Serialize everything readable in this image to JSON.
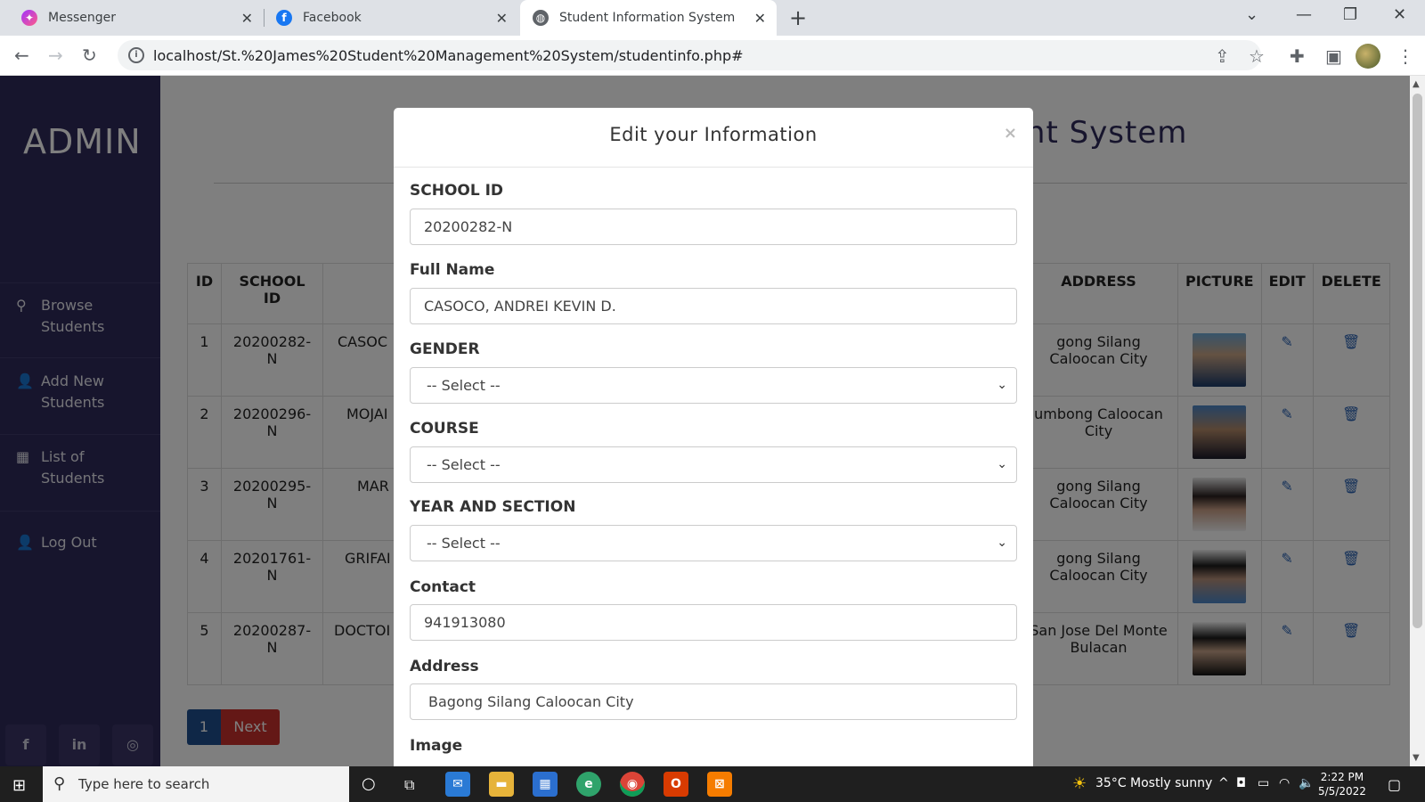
{
  "browser": {
    "tabs": [
      {
        "title": "Messenger",
        "icon": "messenger-icon"
      },
      {
        "title": "Facebook",
        "icon": "facebook-icon"
      },
      {
        "title": "Student Information System",
        "icon": "globe-icon"
      }
    ],
    "url": "localhost/St.%20James%20Student%20Management%20System/studentinfo.php#"
  },
  "sidebar": {
    "title": "ADMIN",
    "items": [
      {
        "label": "Browse Students",
        "icon": "search-icon"
      },
      {
        "label": "Add New Students",
        "icon": "user-icon"
      },
      {
        "label": "List of Students",
        "icon": "table-icon"
      },
      {
        "label": "Log Out",
        "icon": "user-icon"
      }
    ],
    "social": [
      "facebook-icon",
      "linkedin-icon",
      "github-icon"
    ]
  },
  "main": {
    "title_fragment": "ent System",
    "table": {
      "headers": [
        "ID",
        "SCHOOL ID",
        "ADDRESS",
        "PICTURE",
        "EDIT",
        "DELETE"
      ],
      "rows": [
        {
          "id": "1",
          "school_id": "20200282-N",
          "name": "CASOC",
          "address": "gong Silang Caloocan City"
        },
        {
          "id": "2",
          "school_id": "20200296-N",
          "name": "MOJAI",
          "address": "umbong Caloocan City"
        },
        {
          "id": "3",
          "school_id": "20200295-N",
          "name": "MAR",
          "address": "gong Silang Caloocan City"
        },
        {
          "id": "4",
          "school_id": "20201761-N",
          "name": "GRIFAI",
          "address": "gong Silang Caloocan City"
        },
        {
          "id": "5",
          "school_id": "20200287-N",
          "name": "DOCTOI",
          "address": "San Jose Del Monte Bulacan"
        }
      ]
    },
    "pagination": {
      "page": "1",
      "next": "Next"
    }
  },
  "modal": {
    "title": "Edit your Information",
    "close": "×",
    "fields": {
      "school_id": {
        "label": "SCHOOL ID",
        "value": "20200282-N"
      },
      "full_name": {
        "label": "Full Name",
        "value": "CASOCO, ANDREI KEVIN D."
      },
      "gender": {
        "label": "GENDER",
        "value": "-- Select --"
      },
      "course": {
        "label": "COURSE",
        "value": "-- Select --"
      },
      "year_section": {
        "label": "YEAR AND SECTION",
        "value": "-- Select --"
      },
      "contact": {
        "label": "Contact",
        "value": "941913080"
      },
      "address": {
        "label": "Address",
        "value": "Bagong Silang Caloocan City"
      },
      "image": {
        "label": "Image"
      }
    }
  },
  "taskbar": {
    "search_placeholder": "Type here to search",
    "weather": "35°C  Mostly sunny",
    "time": "2:22 PM",
    "date": "5/5/2022"
  }
}
